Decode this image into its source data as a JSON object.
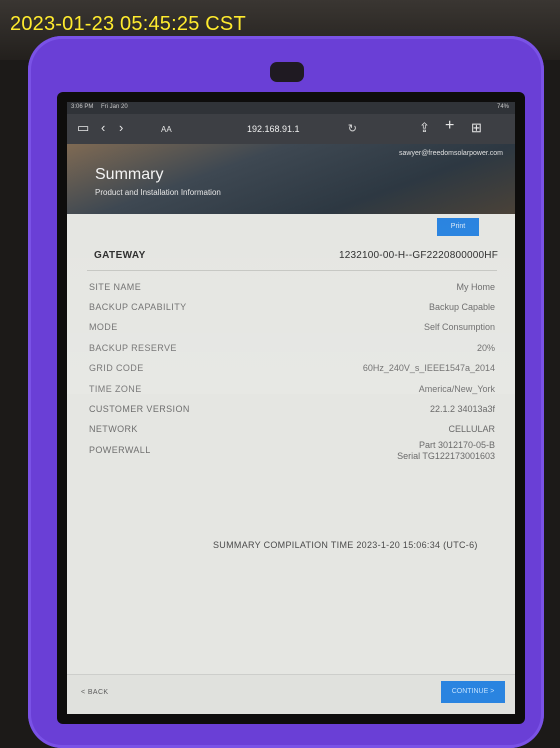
{
  "photo": {
    "timestamp_overlay": "2023-01-23 05:45:25 CST"
  },
  "browser": {
    "status_time": "3:06 PM",
    "status_date": "Fri Jan 20",
    "battery": "74%",
    "aa_label": "AA",
    "url": "192.168.91.1"
  },
  "page": {
    "email": "sawyer@freedomsolarpower.com",
    "title": "Summary",
    "subtitle": "Product and Installation Information",
    "print_label": "Print",
    "gateway": {
      "label": "GATEWAY",
      "value": "1232100-00-H--GF2220800000HF"
    },
    "rows": [
      {
        "label": "SITE NAME",
        "value": "My Home"
      },
      {
        "label": "BACKUP CAPABILITY",
        "value": "Backup Capable"
      },
      {
        "label": "MODE",
        "value": "Self Consumption"
      },
      {
        "label": "BACKUP RESERVE",
        "value": "20%"
      },
      {
        "label": "GRID CODE",
        "value": "60Hz_240V_s_IEEE1547a_2014"
      },
      {
        "label": "TIME ZONE",
        "value": "America/New_York"
      },
      {
        "label": "CUSTOMER VERSION",
        "value": "22.1.2 34013a3f"
      },
      {
        "label": "NETWORK",
        "value": "CELLULAR"
      }
    ],
    "powerwall": {
      "label": "POWERWALL",
      "part": "Part 3012170-05-B",
      "serial": "Serial TG122173001603"
    },
    "compilation_time": "SUMMARY COMPILATION TIME 2023-1-20 15:06:34 (UTC-6)",
    "back_label": "< BACK",
    "continue_label": "CONTINUE >"
  }
}
